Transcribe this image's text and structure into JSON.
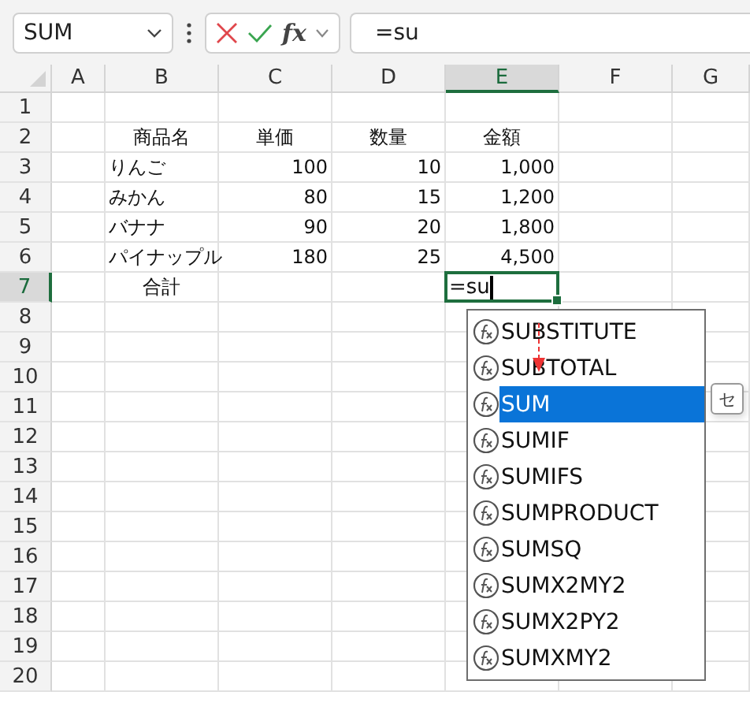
{
  "name_box": {
    "value": "SUM"
  },
  "formula_bar": {
    "fx_label": "fx",
    "value": "=su"
  },
  "columns": [
    {
      "label": "A",
      "selected": false
    },
    {
      "label": "B",
      "selected": false
    },
    {
      "label": "C",
      "selected": false
    },
    {
      "label": "D",
      "selected": false
    },
    {
      "label": "E",
      "selected": true
    },
    {
      "label": "F",
      "selected": false
    },
    {
      "label": "G",
      "selected": false
    }
  ],
  "rows": [
    {
      "label": "1",
      "selected": false
    },
    {
      "label": "2",
      "selected": false
    },
    {
      "label": "3",
      "selected": false
    },
    {
      "label": "4",
      "selected": false
    },
    {
      "label": "5",
      "selected": false
    },
    {
      "label": "6",
      "selected": false
    },
    {
      "label": "7",
      "selected": true
    },
    {
      "label": "8",
      "selected": false
    },
    {
      "label": "9",
      "selected": false
    },
    {
      "label": "10",
      "selected": false
    },
    {
      "label": "11",
      "selected": false
    },
    {
      "label": "12",
      "selected": false
    },
    {
      "label": "13",
      "selected": false
    },
    {
      "label": "14",
      "selected": false
    },
    {
      "label": "15",
      "selected": false
    },
    {
      "label": "16",
      "selected": false
    },
    {
      "label": "17",
      "selected": false
    },
    {
      "label": "18",
      "selected": false
    },
    {
      "label": "19",
      "selected": false
    },
    {
      "label": "20",
      "selected": false
    }
  ],
  "table": {
    "headers": [
      "商品名",
      "単価",
      "数量",
      "金額"
    ],
    "items": [
      {
        "name": "りんご",
        "price": "100",
        "quantity": "10",
        "amount": "1,000"
      },
      {
        "name": "みかん",
        "price": "80",
        "quantity": "15",
        "amount": "1,200"
      },
      {
        "name": "バナナ",
        "price": "90",
        "quantity": "20",
        "amount": "1,800"
      },
      {
        "name": "パイナップル",
        "price": "180",
        "quantity": "25",
        "amount": "4,500"
      }
    ],
    "total": {
      "label": "合計",
      "amount_input": "=su"
    }
  },
  "autocomplete": {
    "items": [
      {
        "label": "SUBSTITUTE",
        "selected": false
      },
      {
        "label": "SUBTOTAL",
        "selected": false
      },
      {
        "label": "SUM",
        "selected": true
      },
      {
        "label": "SUMIF",
        "selected": false
      },
      {
        "label": "SUMIFS",
        "selected": false
      },
      {
        "label": "SUMPRODUCT",
        "selected": false
      },
      {
        "label": "SUMSQ",
        "selected": false
      },
      {
        "label": "SUMX2MY2",
        "selected": false
      },
      {
        "label": "SUMX2PY2",
        "selected": false
      },
      {
        "label": "SUMXMY2",
        "selected": false
      }
    ],
    "tooltip": {
      "text": "セ"
    }
  }
}
